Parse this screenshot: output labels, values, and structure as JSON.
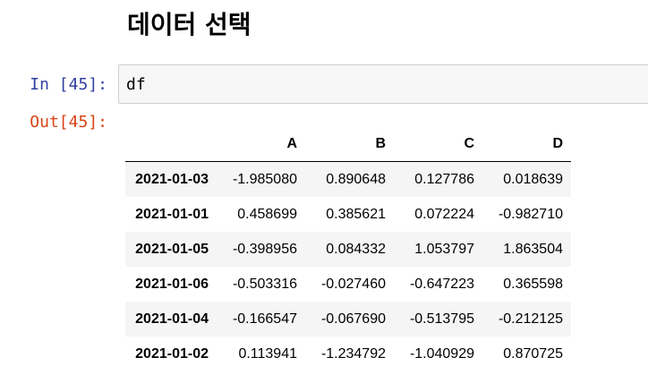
{
  "notebook": {
    "heading": "데이터 선택",
    "input_prompt": "In [45]:",
    "input_code": "df",
    "output_prompt": "Out[45]:"
  },
  "dataframe": {
    "columns": [
      "A",
      "B",
      "C",
      "D"
    ],
    "rows": [
      {
        "index": "2021-01-03",
        "values": [
          "-1.985080",
          "0.890648",
          "0.127786",
          "0.018639"
        ]
      },
      {
        "index": "2021-01-01",
        "values": [
          "0.458699",
          "0.385621",
          "0.072224",
          "-0.982710"
        ]
      },
      {
        "index": "2021-01-05",
        "values": [
          "-0.398956",
          "0.084332",
          "1.053797",
          "1.863504"
        ]
      },
      {
        "index": "2021-01-06",
        "values": [
          "-0.503316",
          "-0.027460",
          "-0.647223",
          "0.365598"
        ]
      },
      {
        "index": "2021-01-04",
        "values": [
          "-0.166547",
          "-0.067690",
          "-0.513795",
          "-0.212125"
        ]
      },
      {
        "index": "2021-01-02",
        "values": [
          "0.113941",
          "-1.234792",
          "-1.040929",
          "0.870725"
        ]
      }
    ]
  },
  "colors": {
    "input_prompt": "#303F9F",
    "output_prompt": "#D84315",
    "input_background": "#f7f7f7",
    "stripe": "#f5f5f5"
  }
}
